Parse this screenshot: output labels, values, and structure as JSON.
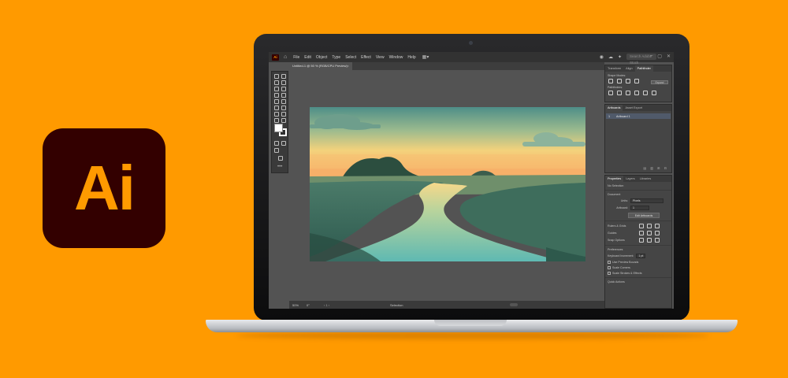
{
  "logo": {
    "text": "Ai"
  },
  "menubar": {
    "app_icon": "Ai",
    "items": [
      "File",
      "Edit",
      "Object",
      "Type",
      "Select",
      "Effect",
      "View",
      "Window",
      "Help"
    ],
    "search_placeholder": "Search Adobe Stock"
  },
  "document": {
    "tab_title": "Untitled-1 @ 50 % (RGB/CPU Preview)",
    "close": "×"
  },
  "status": {
    "zoom": "50%",
    "angle": "0°",
    "artboard_nav": "‹  1  ›",
    "tool": "Selection"
  },
  "panels": {
    "top_tabs": [
      "Transform",
      "Align",
      "Pathfinder"
    ],
    "shape_modes_label": "Shape Modes:",
    "pathfinders_label": "Pathfinders:",
    "expand_label": "Expand",
    "artboards_tabs": [
      "Artboards",
      "Asset Export"
    ],
    "artboard_row": {
      "index": "1",
      "name": "Artboard 1"
    },
    "properties_tabs": [
      "Properties",
      "Layers",
      "Libraries"
    ],
    "no_selection": "No Selection",
    "document_label": "Document",
    "units_label": "Units:",
    "units_value": "Pixels",
    "artboard_label": "Artboard:",
    "artboard_value": "1",
    "edit_artboards": "Edit Artboards",
    "rulers_grids": "Rulers & Grids",
    "guides": "Guides",
    "snap_options": "Snap Options",
    "preferences": "Preferences",
    "keyboard_increment_label": "Keyboard Increment:",
    "keyboard_increment_value": "1 pt",
    "checkbox_preview_bounds": "Use Preview Bounds",
    "checkbox_scale_corners": "Scale Corners",
    "checkbox_scale_strokes": "Scale Strokes & Effects",
    "quick_actions": "Quick Actions"
  },
  "colors": {
    "background": "#FF9A00",
    "logo_bg": "#330000",
    "logo_text": "#FF9A00"
  }
}
